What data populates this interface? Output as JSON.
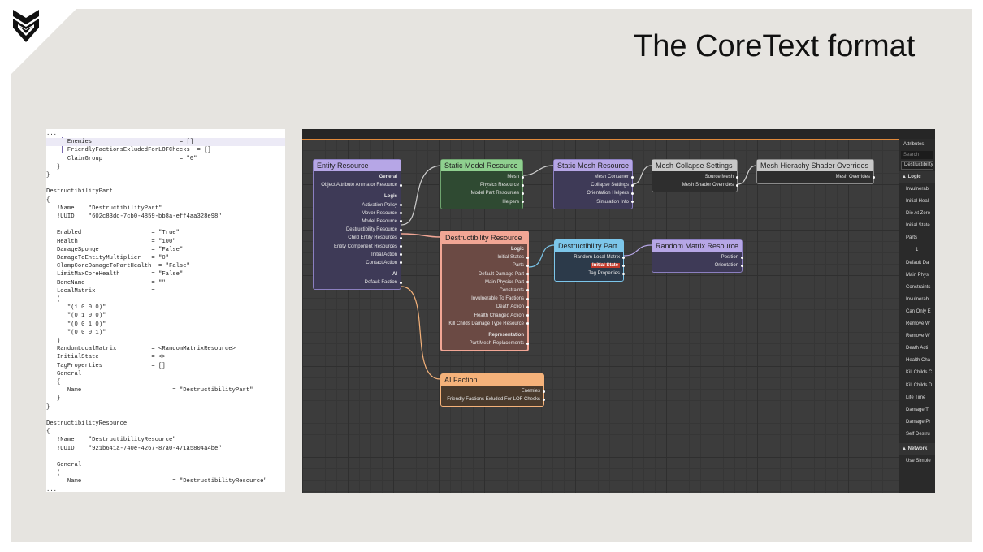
{
  "slide": {
    "title": "The CoreText format",
    "logo": "shield-chevron-logo-icon"
  },
  "code": {
    "lines": [
      "...",
      "      Enemies                         = []",
      "      FriendlyFactionsExludedForLOFChecks  = []",
      "      ClaimGroup                      = \"0\"",
      "   }",
      "}",
      "",
      "DestructibilityPart",
      "{",
      "   !Name    \"DestructibilityPart\"",
      "   !UUID    \"602c83dc-7cb0-4859-bb8a-eff4aa328e98\"",
      "",
      "   Enabled                    = \"True\"",
      "   Health                     = \"100\"",
      "   DamageSponge               = \"False\"",
      "   DamageToEntityMultiplier   = \"0\"",
      "   ClampCoreDamageToPartHealth  = \"False\"",
      "   LimitMaxCoreHealth         = \"False\"",
      "   BoneName                   = \"\"",
      "   LocalMatrix                =",
      "   (",
      "      \"(1 0 0 0)\"",
      "      \"(0 1 0 0)\"",
      "      \"(0 0 1 0)\"",
      "      \"(0 0 0 1)\"",
      "   )",
      "   RandomLocalMatrix          = <RandomMatrixResource>",
      "   InitialState               = <>",
      "   TagProperties              = []",
      "   General",
      "   {",
      "      Name                          = \"DestructibilityPart\"",
      "   }",
      "}",
      "",
      "DestructibilityResource",
      "{",
      "   !Name    \"DestructibilityResource\"",
      "   !UUID    \"921b641a-740e-4267-87a0-471a5804a4be\"",
      "",
      "   General",
      "   (",
      "      Name                          = \"DestructibilityResource\"",
      "..."
    ]
  },
  "editor": {
    "colors": {
      "purple": "#b6a6e6",
      "green": "#8fd08f",
      "salmon": "#f2a695",
      "blue": "#7cc6ea",
      "orange": "#f5b27a",
      "gray": "#c8c8c8"
    },
    "nodes": {
      "entity_resource": {
        "title": "Entity Resource",
        "rows": [
          {
            "t": "General",
            "sec": true
          },
          {
            "t": "Object Attribute Animator Resource"
          },
          {
            "t": "Logic",
            "sec": true,
            "gap": true
          },
          {
            "t": "Activation Policy"
          },
          {
            "t": "Mover Resource"
          },
          {
            "t": "Model Resource"
          },
          {
            "t": "Destructibility Resource"
          },
          {
            "t": "Child Entity Resources"
          },
          {
            "t": "Entity Component Resources"
          },
          {
            "t": "Initial Action"
          },
          {
            "t": "Contact Action"
          },
          {
            "t": "AI",
            "sec": true,
            "gap": true
          },
          {
            "t": "Default Faction"
          }
        ]
      },
      "static_model_resource": {
        "title": "Static Model Resource",
        "rows": [
          {
            "t": "Mesh"
          },
          {
            "t": "Physics Resource"
          },
          {
            "t": "Model Part Resources"
          },
          {
            "t": "Helpers"
          }
        ]
      },
      "static_mesh_resource": {
        "title": "Static Mesh Resource",
        "rows": [
          {
            "t": "Mesh Container"
          },
          {
            "t": "Collapse Settings"
          },
          {
            "t": "Orientation Helpers"
          },
          {
            "t": "Simulation Info"
          }
        ]
      },
      "mesh_collapse_settings": {
        "title": "Mesh Collapse Settings",
        "rows": [
          {
            "t": "Source Mesh"
          },
          {
            "t": "Mesh Shader Overrides"
          }
        ]
      },
      "mesh_hierachy_shader_overrides": {
        "title": "Mesh Hierachy Shader Overrides",
        "rows": [
          {
            "t": "Mesh Overrides"
          }
        ]
      },
      "destructibility_resource": {
        "title": "Destructibility Resource",
        "rows": [
          {
            "t": "Logic",
            "sec": true
          },
          {
            "t": "Initial States"
          },
          {
            "t": "Parts"
          },
          {
            "t": "Default Damage Part"
          },
          {
            "t": "Main Physics Part"
          },
          {
            "t": "Constraints"
          },
          {
            "t": "Invulnerable To Factions"
          },
          {
            "t": "Death Action"
          },
          {
            "t": "Health Changed Action"
          },
          {
            "t": "Kill Childs Damage Type Resource"
          },
          {
            "t": "Representation",
            "sec": true,
            "gap": true
          },
          {
            "t": "Part Mesh Replacements"
          }
        ]
      },
      "destructibility_part": {
        "title": "Destructibility Part",
        "rows": [
          {
            "t": "Random Local Matrix"
          },
          {
            "t": "Initial State",
            "selected": true
          },
          {
            "t": "Tag Properties"
          }
        ]
      },
      "random_matrix_resource": {
        "title": "Random Matrix Resource",
        "rows": [
          {
            "t": "Position"
          },
          {
            "t": "Orientation"
          }
        ]
      },
      "ai_faction": {
        "title": "AI Faction",
        "rows": [
          {
            "t": "Enemies"
          },
          {
            "t": "Friendly Factions Exluded For LOF Checks"
          }
        ]
      }
    }
  },
  "attributes": {
    "title": "Attributes",
    "search_placeholder": "Search",
    "selected": "Destructibility",
    "logic_label": "Logic",
    "logic_rows": [
      "Invulnerab",
      "Initial Heal",
      "Die At Zero",
      "Initial State",
      "Parts",
      "1",
      "Default Da",
      "Main Physi",
      "Constraints",
      "Invulnerab",
      "Can Only E",
      "Remove W",
      "Remove W",
      "Death Acti",
      "Health Cha",
      "Kill Childs C",
      "Kill Childs D",
      "Life Time",
      "Damage Ti",
      "Damage Pr",
      "Self Destru"
    ],
    "network_label": "Network",
    "network_rows": [
      "Use Simple"
    ]
  }
}
